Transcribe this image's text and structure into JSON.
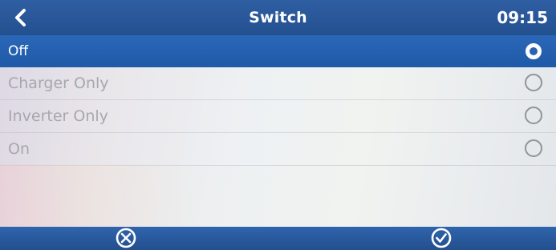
{
  "header": {
    "back_icon": "chevron-left-icon",
    "title": "Switch",
    "time": "09:15"
  },
  "options": [
    {
      "label": "Off",
      "selected": true
    },
    {
      "label": "Charger Only",
      "selected": false
    },
    {
      "label": "Inverter Only",
      "selected": false
    },
    {
      "label": "On",
      "selected": false
    }
  ],
  "footer": {
    "cancel_icon": "cancel-circle-icon",
    "confirm_icon": "check-circle-icon"
  },
  "colors": {
    "header_blue": "#23508f",
    "selected_blue": "#1f5aa8",
    "text_gray": "#a7a8ad"
  }
}
